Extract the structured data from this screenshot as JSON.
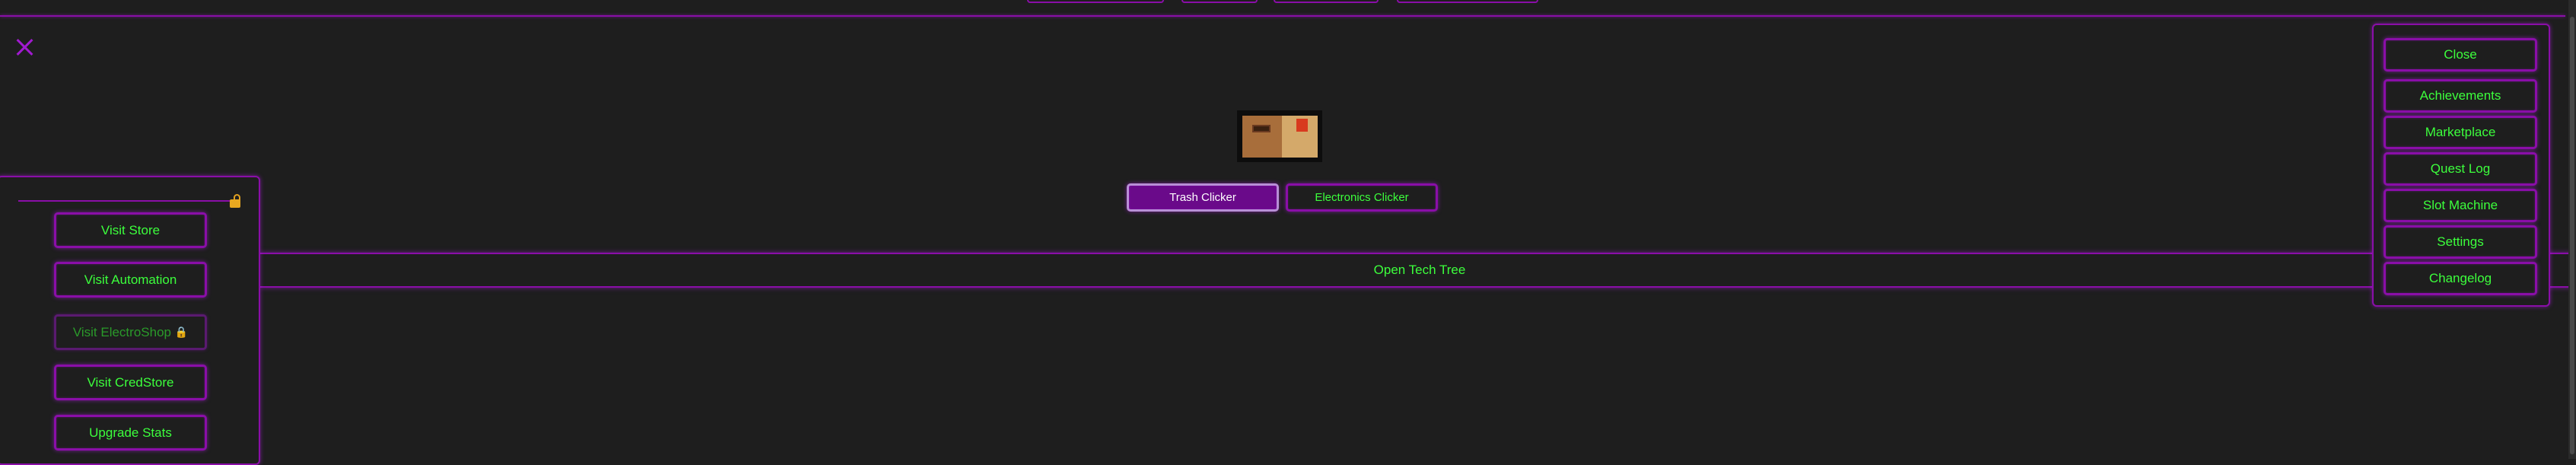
{
  "left_panel": {
    "buttons": [
      {
        "label": "Visit Store",
        "locked": false
      },
      {
        "label": "Visit Automation",
        "locked": false
      },
      {
        "label": "Visit ElectroShop",
        "lock_glyph": "🔒",
        "locked": true
      },
      {
        "label": "Visit CredStore",
        "locked": false
      },
      {
        "label": "Upgrade Stats",
        "locked": false
      }
    ]
  },
  "clicker_tabs": [
    {
      "label": "Trash Clicker",
      "active": true
    },
    {
      "label": "Electronics Clicker",
      "active": false
    }
  ],
  "tech_tree": {
    "label": "Open Tech Tree"
  },
  "right_menu": {
    "items": [
      "Close",
      "Achievements",
      "Marketplace",
      "Quest Log",
      "Slot Machine",
      "Settings",
      "Changelog"
    ]
  },
  "icons": {
    "close": "close-x-icon",
    "crate": "trash-crate-icon",
    "unlock": "unlock-padlock-icon"
  },
  "colors": {
    "background": "#1e1e1e",
    "border_purple": "#8a0ea8",
    "text_green": "#3cff3c",
    "active_tab": "#6a0a8a"
  }
}
